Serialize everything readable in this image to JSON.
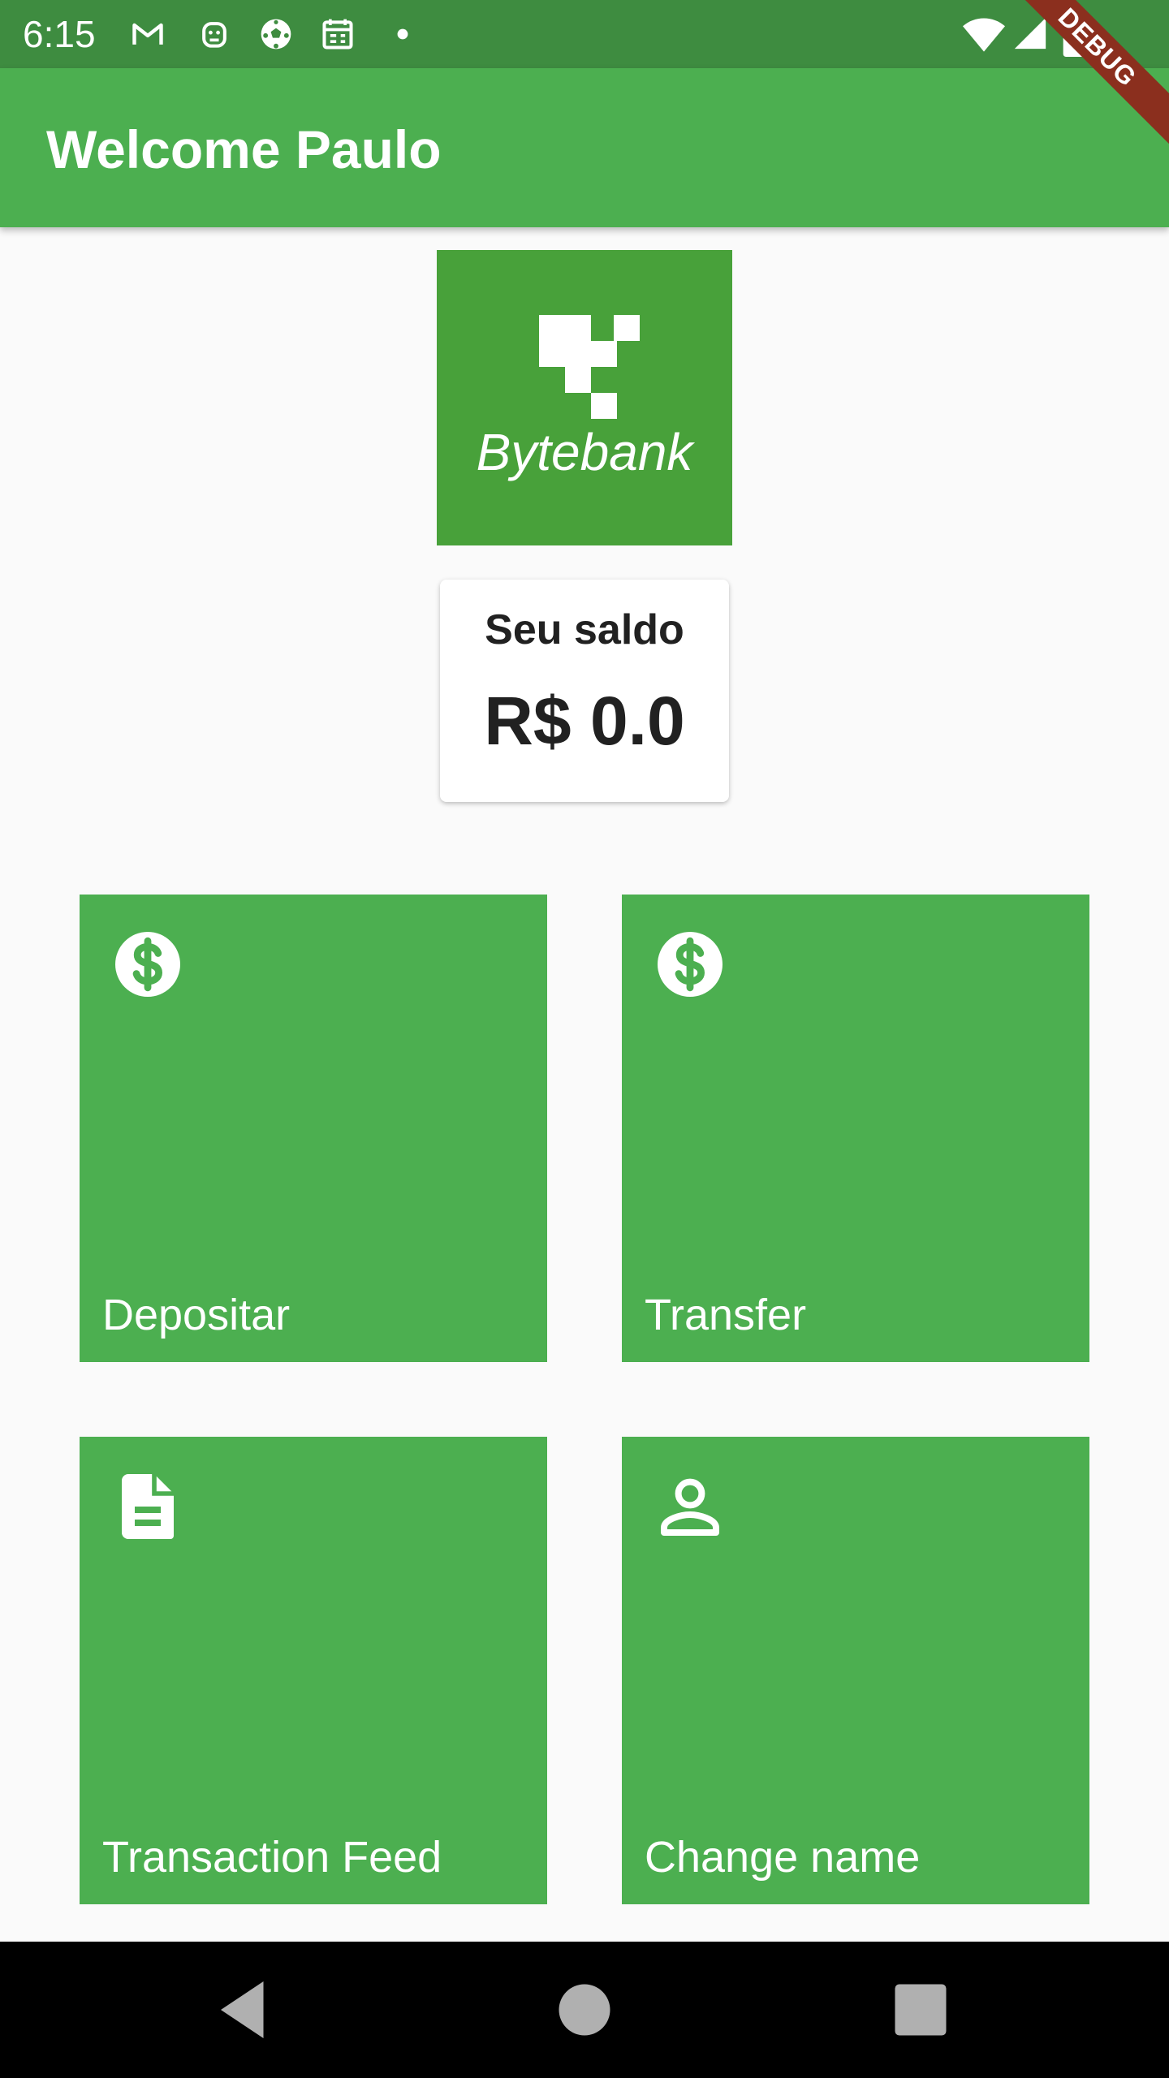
{
  "status_bar": {
    "time": "6:15",
    "icons": [
      "gmail-icon",
      "robot-icon",
      "soccer-ball-icon",
      "calendar-icon",
      "dot-icon",
      "wifi-icon",
      "signal-icon",
      "battery-icon"
    ]
  },
  "debug_banner": "DEBUG",
  "app_bar": {
    "title": "Welcome Paulo"
  },
  "logo": {
    "text": "Bytebank"
  },
  "balance": {
    "label": "Seu saldo",
    "value": "R$ 0.0"
  },
  "tiles": [
    {
      "label": "Depositar",
      "icon": "dollar-icon"
    },
    {
      "label": "Transfer",
      "icon": "dollar-icon"
    },
    {
      "label": "Transaction Feed",
      "icon": "document-icon"
    },
    {
      "label": "Change name",
      "icon": "person-icon"
    }
  ],
  "colors": {
    "primary": "#4caf50",
    "primary_dark": "#3e8c40",
    "logo_background": "#48a13a",
    "debug_banner": "#8b2f1e"
  }
}
